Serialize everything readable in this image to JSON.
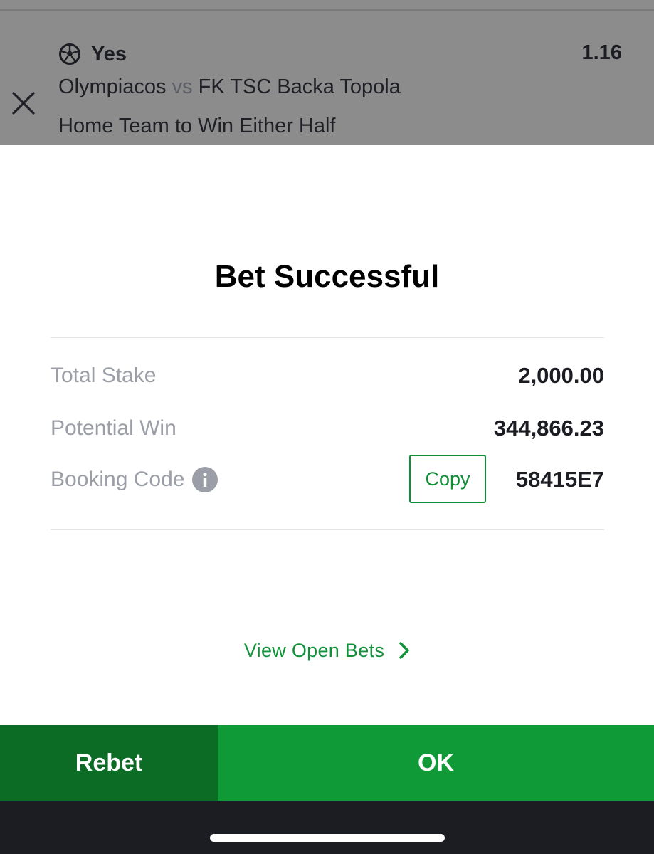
{
  "backdrop": {
    "selection": "Yes",
    "odds": "1.16",
    "home_team": "Olympiacos",
    "vs": "vs",
    "away_team": "FK TSC Backa Topola",
    "market": "Home Team to Win Either Half",
    "icons": {
      "close": "close-icon",
      "sport": "soccer-ball-icon"
    }
  },
  "dialog": {
    "title": "Bet Successful",
    "total_stake_label": "Total Stake",
    "total_stake_value": "2,000.00",
    "potential_win_label": "Potential Win",
    "potential_win_value": "344,866.23",
    "booking_code_label": "Booking Code",
    "copy_label": "Copy",
    "booking_code_value": "58415E7",
    "view_open_bets_label": "View Open Bets",
    "icons": {
      "info": "info-icon",
      "chevron": "chevron-right-icon"
    }
  },
  "actions": {
    "rebet_label": "Rebet",
    "ok_label": "OK"
  },
  "colors": {
    "brand_green": "#0f9a37",
    "brand_green_dark": "#0c6b25",
    "link_green": "#12913a",
    "label_gray": "#9b9ea6",
    "text_dark": "#1b1d22",
    "overlay_gray": "#8c8c8c",
    "bottom_bar": "#1b1d22"
  }
}
